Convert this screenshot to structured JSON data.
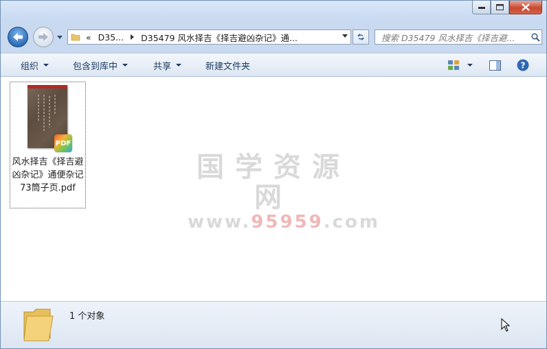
{
  "window": {
    "minimize_label": "",
    "maximize_label": "",
    "close_label": ""
  },
  "address": {
    "chevron": "«",
    "crumb1": "D35...",
    "crumb2": "D35479 风水择吉《择吉避凶杂记》通..."
  },
  "search": {
    "placeholder": "搜索 D35479 风水择吉《择吉避..."
  },
  "toolbar": {
    "organize": "组织",
    "include_library": "包含到库中",
    "share": "共享",
    "new_folder": "新建文件夹"
  },
  "files": [
    {
      "name": "风水择吉《择吉避凶杂记》通便杂记 73筒子页.pdf",
      "type_badge": "PDF"
    }
  ],
  "watermark": {
    "line1": "国学资源网",
    "line2_pre": "www.",
    "line2_red": "95959",
    "line2_post": ".com"
  },
  "status": {
    "count": "1 个对象"
  },
  "colors": {
    "frame": "#c9daf0",
    "close_red": "#c8482f",
    "toolbar_text": "#1e3a5f"
  },
  "icons": [
    "back-arrow-icon",
    "forward-arrow-icon",
    "folder-icon",
    "refresh-icon",
    "search-icon",
    "view-options-icon",
    "preview-pane-icon",
    "help-icon",
    "pdf-icon",
    "cursor-icon"
  ]
}
